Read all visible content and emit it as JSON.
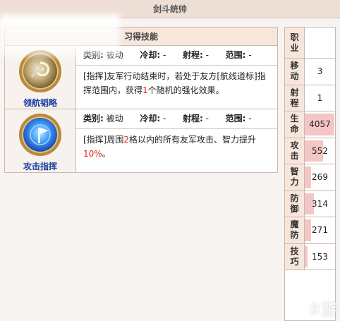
{
  "page_title": "剑斗统帅",
  "skills_section": {
    "header": "习得技能",
    "meta_labels": {
      "type": "类别:",
      "cooldown": "冷却:",
      "range": "射程:",
      "area": "范围:"
    },
    "skills": [
      {
        "name": "领航韬略",
        "icon": "navigation-strategy-icon",
        "type_value": "被动",
        "cooldown_value": "-",
        "range_value": "-",
        "area_value": "-",
        "desc_before": "[指挥]友军行动结束时，若处于友方[航线道标]指挥范围内，获得",
        "desc_highlight": "1",
        "desc_after": "个随机的强化效果。"
      },
      {
        "name": "攻击指挥",
        "icon": "attack-command-icon",
        "type_value": "被动",
        "cooldown_value": "-",
        "range_value": "-",
        "area_value": "-",
        "desc_before": "[指挥]周围",
        "desc_highlight": "2",
        "desc_mid": "格以内的所有友军攻击、智力提升",
        "desc_highlight2": "10%",
        "desc_after": "。"
      }
    ]
  },
  "stats": {
    "class_label": "职业",
    "class_value": "",
    "rows": [
      {
        "label": "移动",
        "value": "3",
        "fraction": 0
      },
      {
        "label": "射程",
        "value": "1",
        "fraction": 0
      },
      {
        "label": "生命",
        "value": "4057",
        "fraction": 0.98
      },
      {
        "label": "攻击",
        "value": "552",
        "fraction": 0.6
      },
      {
        "label": "智力",
        "value": "269",
        "fraction": 0.22
      },
      {
        "label": "防御",
        "value": "314",
        "fraction": 0.3
      },
      {
        "label": "魔防",
        "value": "271",
        "fraction": 0.22
      },
      {
        "label": "技巧",
        "value": "153",
        "fraction": 0.1
      }
    ]
  },
  "colors": {
    "highlight_red": "#e0201a",
    "skill_name_blue": "#1b3fa0",
    "stat_bar": "#f5c6c6",
    "header_bg": "#f6e6dc"
  },
  "watermark": "9游"
}
